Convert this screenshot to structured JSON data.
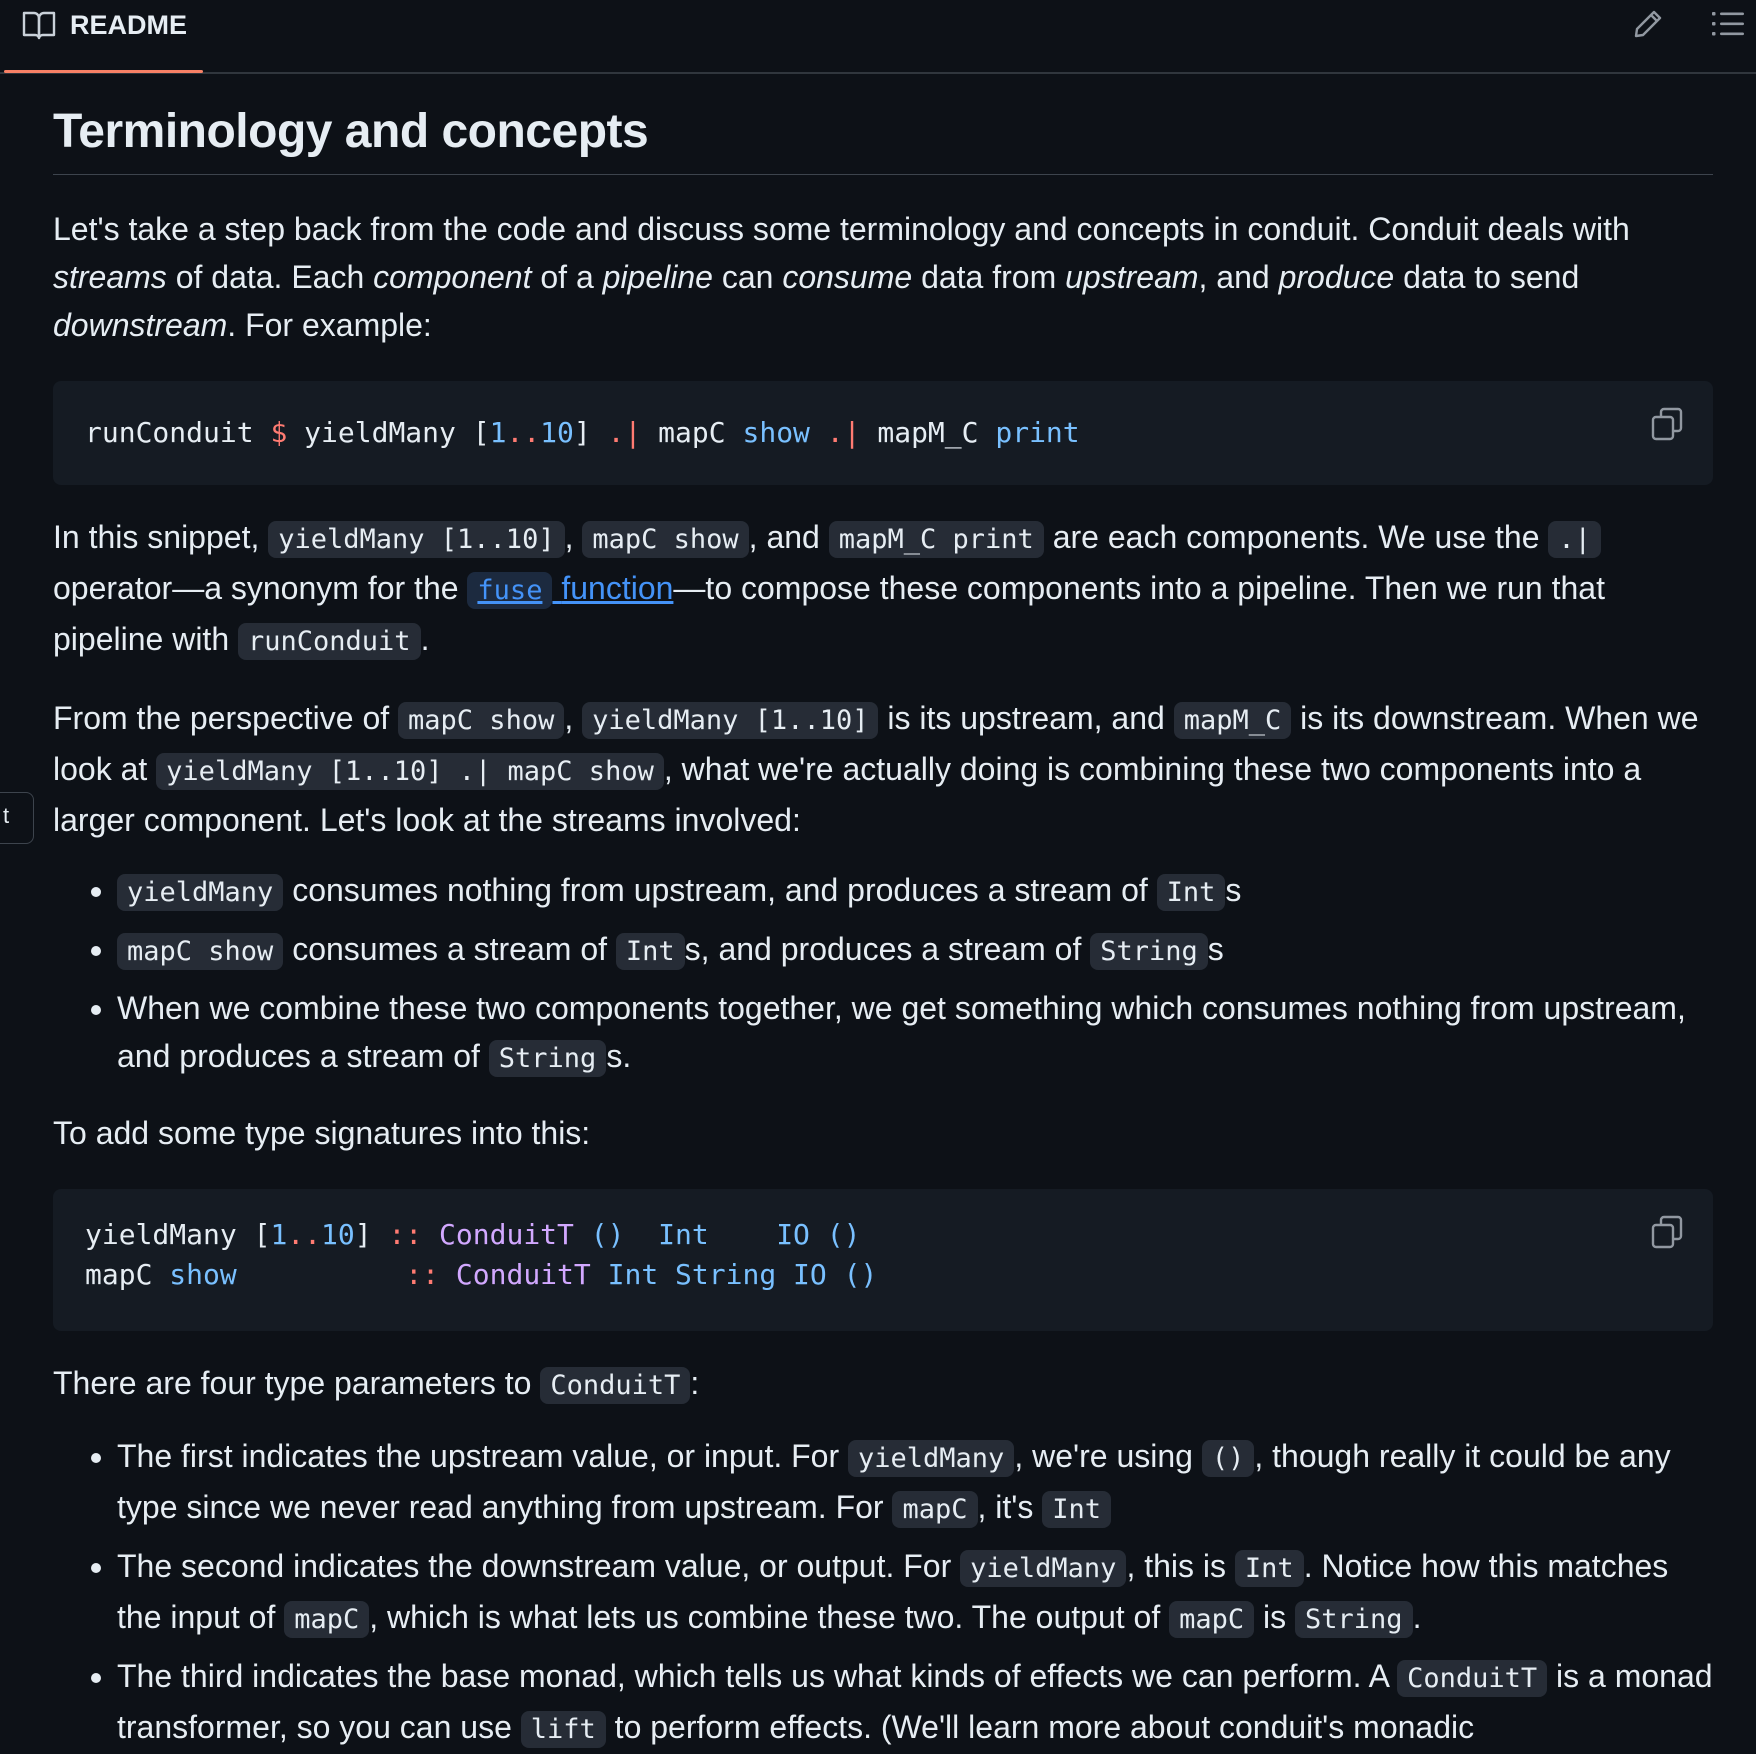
{
  "header": {
    "tab_label": "README",
    "side_tab_label": "t"
  },
  "article": {
    "title": "Terminology and concepts",
    "p1": {
      "t1": "Let's take a step back from the code and discuss some terminology and concepts in conduit. Conduit deals with ",
      "e1": "streams",
      "t2": " of data. Each ",
      "e2": "component",
      "t3": " of a ",
      "e3": "pipeline",
      "t4": " can ",
      "e4": "consume",
      "t5": " data from ",
      "e5": "upstream",
      "t6": ", and ",
      "e6": "produce",
      "t7": " data to send ",
      "e7": "downstream",
      "t8": ". For example:"
    },
    "code1": {
      "a": "runConduit ",
      "b": "$",
      "c": " yieldMany [",
      "d": "1",
      "e": "..",
      "f": "10",
      "g": "] ",
      "h": ".|",
      "i": " mapC ",
      "j": "show",
      "k": " ",
      "l": ".|",
      "m": " mapM_C ",
      "n": "print"
    },
    "p2": {
      "t1": "In this snippet, ",
      "c1": "yieldMany [1..10]",
      "t2": ", ",
      "c2": "mapC show",
      "t3": ", and ",
      "c3": "mapM_C print",
      "t4": " are each components. We use the ",
      "c4": ".|",
      "t5": " operator—a synonym for the ",
      "link_code": "fuse",
      "link_text": "function",
      "t6": "—to compose these components into a pipeline. Then we run that pipeline with ",
      "c5": "runConduit",
      "t7": "."
    },
    "p3": {
      "t1": "From the perspective of ",
      "c1": "mapC show",
      "t2": ", ",
      "c2": "yieldMany [1..10]",
      "t3": " is its upstream, and ",
      "c3": "mapM_C",
      "t4": " is its downstream. When we look at ",
      "c4": "yieldMany [1..10] .| mapC show",
      "t5": ", what we're actually doing is combining these two components into a larger component. Let's look at the streams involved:"
    },
    "list1": {
      "i1": {
        "c1": "yieldMany",
        "t1": " consumes nothing from upstream, and produces a stream of ",
        "c2": "Int",
        "t2": "s"
      },
      "i2": {
        "c1": "mapC show",
        "t1": " consumes a stream of ",
        "c2": "Int",
        "t2": "s, and produces a stream of ",
        "c3": "String",
        "t3": "s"
      },
      "i3": {
        "t1": "When we combine these two components together, we get something which consumes nothing from upstream, and produces a stream of ",
        "c1": "String",
        "t2": "s."
      }
    },
    "p4": "To add some type signatures into this:",
    "code2": {
      "l1": {
        "a": "yieldMany [",
        "b": "1",
        "c": "..",
        "d": "10",
        "e": "] ",
        "f": "::",
        "g": " ",
        "h": "ConduitT",
        "i": " () ",
        "j": " Int    ",
        "k": "IO",
        "l": " ()"
      },
      "l2": {
        "a": "mapC ",
        "b": "show",
        "c": "          ",
        "f": "::",
        "g": " ",
        "h": "ConduitT",
        "i": " ",
        "j": "Int String ",
        "k": "IO",
        "l": " ()"
      }
    },
    "p5": {
      "t1": "There are four type parameters to ",
      "c1": "ConduitT",
      "t2": ":"
    },
    "list2": {
      "i1": {
        "t1": "The first indicates the upstream value, or input. For ",
        "c1": "yieldMany",
        "t2": ", we're using ",
        "c2": "()",
        "t3": ", though really it could be any type since we never read anything from upstream. For ",
        "c3": "mapC",
        "t4": ", it's ",
        "c4": "Int"
      },
      "i2": {
        "t1": "The second indicates the downstream value, or output. For ",
        "c1": "yieldMany",
        "t2": ", this is ",
        "c2": "Int",
        "t3": ". Notice how this matches the input of ",
        "c3": "mapC",
        "t4": ", which is what lets us combine these two. The output of ",
        "c4": "mapC",
        "t5": " is ",
        "c5": "String",
        "t6": "."
      },
      "i3": {
        "t1": "The third indicates the base monad, which tells us what kinds of effects we can perform. A ",
        "c1": "ConduitT",
        "t2": " is a monad transformer, so you can use ",
        "c2": "lift",
        "t3": " to perform effects. (We'll learn more about conduit's monadic"
      }
    }
  },
  "colors": {
    "background": "#0d1117",
    "text": "#e6edf3",
    "accent_tab": "#f78166",
    "link": "#4493f8",
    "operator": "#ff7b72",
    "number": "#79c0ff",
    "type": "#d2a8ff"
  },
  "icons": [
    "book-icon",
    "edit-icon",
    "toc-icon",
    "copy-icon"
  ]
}
